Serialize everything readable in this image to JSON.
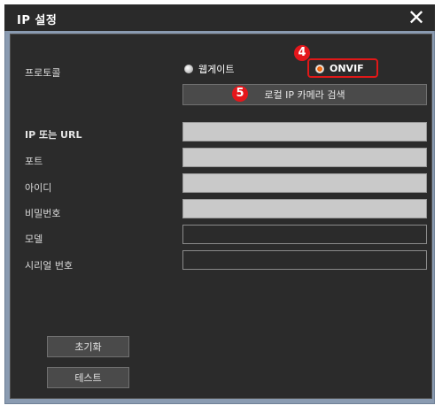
{
  "dialog": {
    "title": "IP 설정",
    "close_glyph": "✕"
  },
  "protocol": {
    "label": "프로토콜",
    "options": [
      {
        "label": "웹게이트",
        "selected": false
      },
      {
        "label": "ONVIF",
        "selected": true
      }
    ],
    "search_button": "로컬 IP 카메라 검색"
  },
  "callouts": {
    "step4": "4",
    "step5": "5"
  },
  "fields": {
    "ip_url": {
      "label": "IP 또는 URL",
      "value": ""
    },
    "port": {
      "label": "포트",
      "value": ""
    },
    "user_id": {
      "label": "아이디",
      "value": ""
    },
    "password": {
      "label": "비밀번호",
      "value": ""
    },
    "model": {
      "label": "모델",
      "value": ""
    },
    "serial": {
      "label": "시리얼 번호",
      "value": ""
    }
  },
  "buttons": {
    "reset": "초기화",
    "test": "테스트"
  },
  "colors": {
    "callout": "#e4161b",
    "panel": "#2b2b2b",
    "frame": "#8a9bb1"
  }
}
